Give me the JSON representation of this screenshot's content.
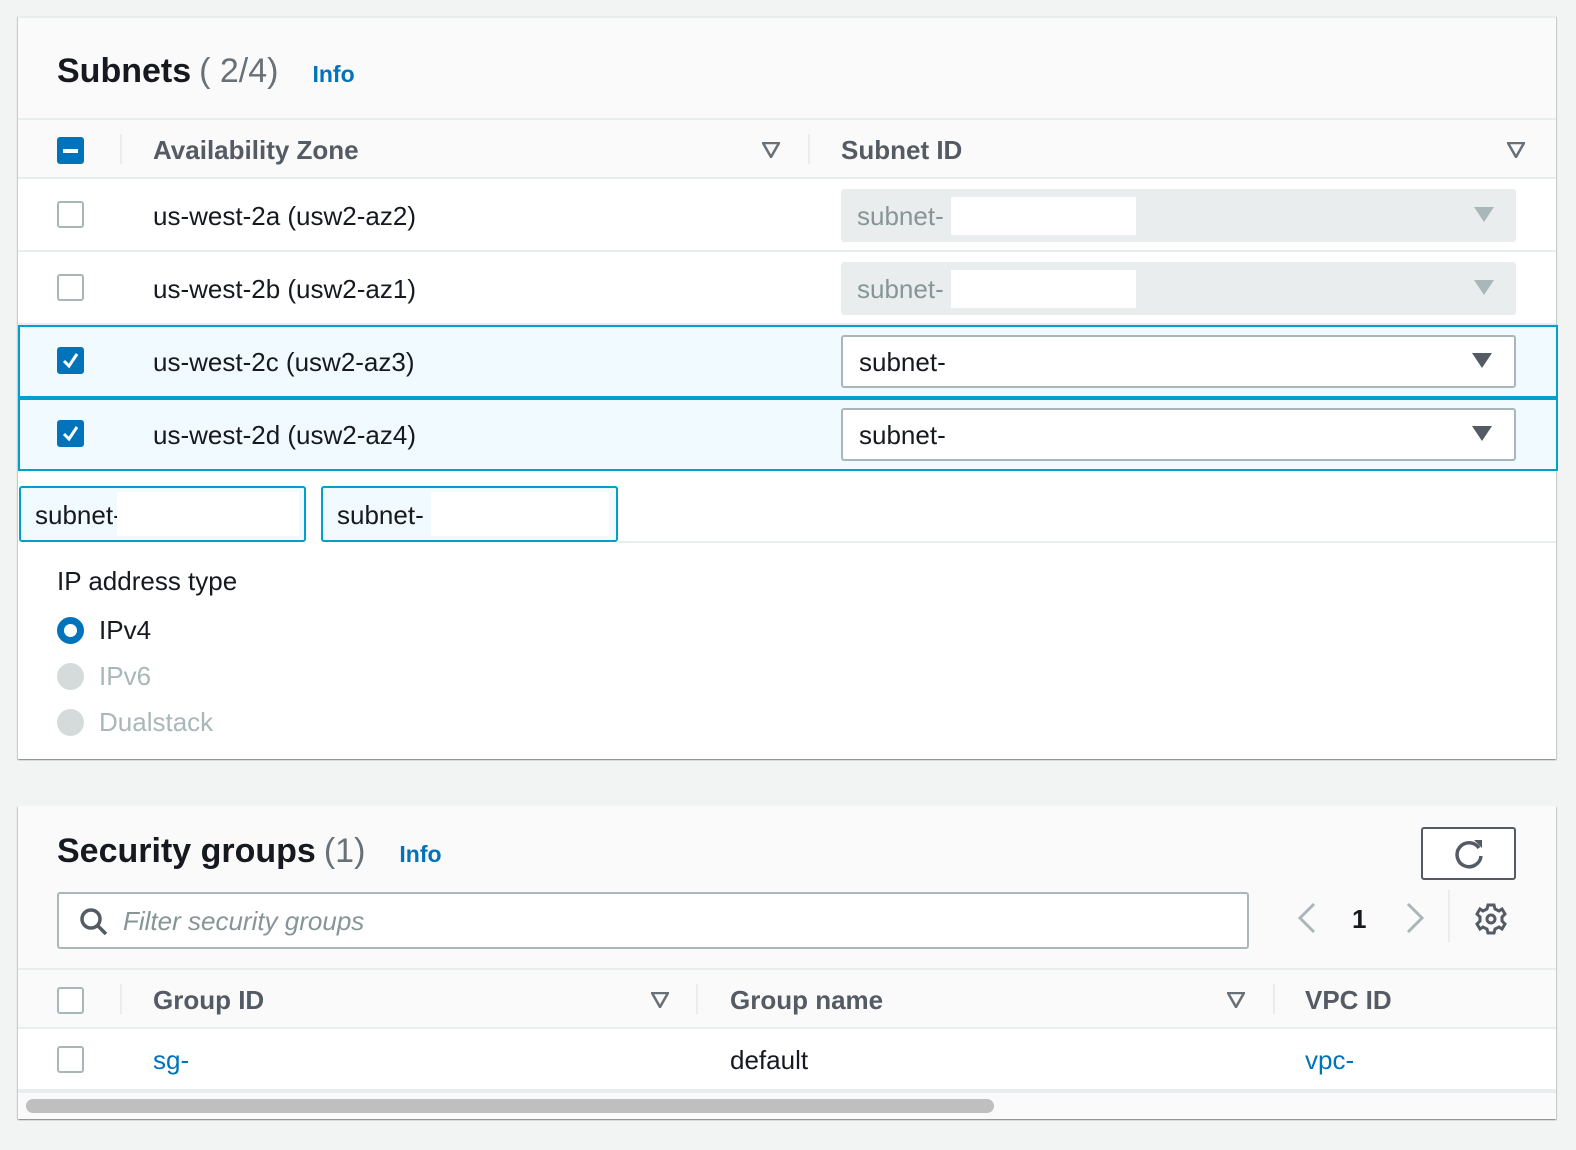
{
  "subnets": {
    "title": "Subnets",
    "count": "( 2/4)",
    "info_label": "Info",
    "columns": [
      "Availability Zone",
      "Subnet ID"
    ],
    "rows": [
      {
        "az": "us-west-2a (usw2-az2)",
        "subnet": "subnet-",
        "checked": false,
        "disabled": true
      },
      {
        "az": "us-west-2b (usw2-az1)",
        "subnet": "subnet-",
        "checked": false,
        "disabled": true
      },
      {
        "az": "us-west-2c (usw2-az3)",
        "subnet": "subnet-",
        "checked": true,
        "disabled": false
      },
      {
        "az": "us-west-2d (usw2-az4)",
        "subnet": "subnet-",
        "checked": true,
        "disabled": false
      }
    ],
    "tokens": [
      "subnet-",
      "subnet-"
    ],
    "ip_address_type": {
      "label": "IP address type",
      "options": [
        {
          "label": "IPv4",
          "selected": true,
          "disabled": false
        },
        {
          "label": "IPv6",
          "selected": false,
          "disabled": true
        },
        {
          "label": "Dualstack",
          "selected": false,
          "disabled": true
        }
      ]
    }
  },
  "security_groups": {
    "title": "Security groups",
    "count": "(1)",
    "info_label": "Info",
    "filter_placeholder": "Filter security groups",
    "page": "1",
    "columns": [
      "Group ID",
      "Group name",
      "VPC ID"
    ],
    "rows": [
      {
        "group_id": "sg-",
        "group_name": "default",
        "vpc_id": "vpc-",
        "checked": false
      }
    ]
  },
  "colors": {
    "accent": "#0073bb",
    "selected_border": "#00a1c9",
    "selected_bg": "#f1faff"
  }
}
